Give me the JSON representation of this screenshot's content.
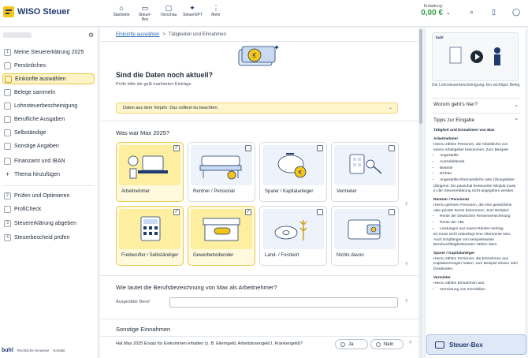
{
  "app": {
    "name": "WISO Steuer"
  },
  "topnav": [
    {
      "label": "Startseite",
      "icon": "home-icon"
    },
    {
      "label": "Steuer-Box",
      "icon": "box-icon"
    },
    {
      "label": "Vorschau",
      "icon": "preview-icon"
    },
    {
      "label": "SteuerGPT",
      "icon": "chat-icon"
    },
    {
      "label": "Mehr",
      "icon": "more-icon"
    }
  ],
  "refund": {
    "label": "Erstattung:",
    "value": "0,00 €"
  },
  "sidebar": {
    "items": [
      {
        "num": "1",
        "label": "Meine Steuererklärung 2025"
      },
      {
        "label": "Persönliches"
      },
      {
        "label": "Einkünfte auswählen"
      },
      {
        "label": "Belege sammeln"
      },
      {
        "label": "Lohnsteuerbescheinigung"
      },
      {
        "label": "Berufliche Ausgaben"
      },
      {
        "label": "Selbständige"
      },
      {
        "label": "Sonstige Angaben"
      },
      {
        "label": "Finanzamt und IBAN"
      },
      {
        "label": "Thema hinzufügen"
      },
      {
        "num": "2",
        "label": "Prüfen und Optimieren"
      },
      {
        "label": "ProfiCheck"
      },
      {
        "num": "3",
        "label": "Steuererklärung abgeben"
      },
      {
        "num": "4",
        "label": "Steuerbescheid prüfen"
      }
    ],
    "footer": {
      "brand": "buhl",
      "legal": "Rechtliche Hinweise",
      "contact": "Kontakt"
    }
  },
  "breadcrumb": {
    "link": "Einkünfte auswählen",
    "sep": ">",
    "current": "Tätigkeiten und Einnahmen"
  },
  "main": {
    "title": "Sind die Daten noch aktuell?",
    "subtitle": "Prüfe bitte die gelb markierten Einträge.",
    "note": "Daten aus dem Vorjahr: Das solltest du beachten.",
    "question1": "Was war Max 2025?",
    "cards": [
      {
        "label": "Arbeitnehmer",
        "checked": true
      },
      {
        "label": "Rentner / Pensionär",
        "checked": false
      },
      {
        "label": "Sparer / Kapitalanleger",
        "checked": false
      },
      {
        "label": "Vermieter",
        "checked": false
      },
      {
        "label": "Freiberufler / Selbständiger",
        "checked": true
      },
      {
        "label": "Gewerbetreibender",
        "checked": true
      },
      {
        "label": "Land- / Forstwirt",
        "checked": false
      },
      {
        "label": "Nichts davon",
        "checked": false
      }
    ],
    "help": "?",
    "question2": "Wie lautet die Berufsbezeichnung von Max als Arbeitnehmer?",
    "job_label": "Ausgeübter Beruf",
    "job_value": "",
    "section2": "Sonstige Einnahmen",
    "question3": "Hat Max 2025 Ersatz für Einkommen erhalten (z. B. Elterngeld, Arbeitslosengeld I, Krankengeld)?",
    "yes": "Ja",
    "no": "Nein"
  },
  "right": {
    "video_brand": "buhl",
    "video_caption": "Die Lohnsteuerbescheinigung: Ein wichtiger Beleg",
    "worum": "Worum geht's hier?",
    "tipps": "Tipps zur Eingabe",
    "tips": {
      "heading": "Tätigkeit und Einnahmen von Max",
      "arbeitnehmer_title": "Arbeitnehmer",
      "arbeitnehmer_text": "Hierzu zählen Personen, die Arbeitslohn von einem Arbeitgeber bekommen. Zum Beispiel:",
      "arbeitnehmer_list": [
        "Angestellte",
        "Auszubildende",
        "Beamte",
        "Richter",
        "Angestellte Ehrenamtliche oder Übungsleiter"
      ],
      "minijob": "Übrigens: Ein pauschal besteuerter Minijob muss in der Steuererklärung nicht angegeben werden.",
      "rentner_title": "Rentner / Pensionär",
      "rentner_text": "Hierzu gehören Personen, die eine gesetzliche oder private Rente bekommen. Zum Beispiel:",
      "rentner_list": [
        "Rente der Deutschen Rentenversicherung",
        "Rente der VBL",
        "Leistungen aus einem Riester-Vertrag"
      ],
      "rentner_note": "Es muss nicht unbedingt eine Altersrente sein. Auch Empfänger von beispielsweise Berufsunfähigkeitsrenten zählen dazu.",
      "sparer_title": "Sparer / Kapitalanleger",
      "sparer_text": "Hierzu zählen Personen, die Einnahmen aus Kapitalvermögen hatten, zum Beispiel Zinsen oder Dividenden.",
      "vermieter_title": "Vermieter",
      "vermieter_text": "Hierzu zählen Einnahmen aus:",
      "vermieter_list": [
        "Vermietung von Immobilien"
      ]
    },
    "steuer_box": "Steuer-Box"
  },
  "colors": {
    "accent_yellow": "#f5c518",
    "brand_blue": "#1f3a6e",
    "refund_green": "#2f9e44"
  }
}
